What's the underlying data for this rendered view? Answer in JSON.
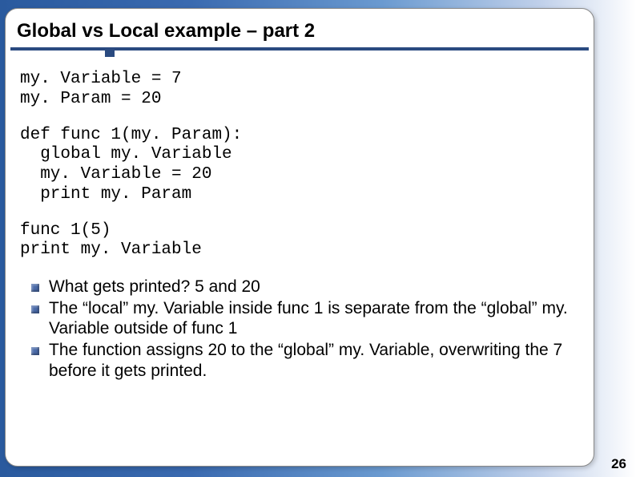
{
  "title": "Global vs Local example – part 2",
  "code": {
    "block1": "my. Variable = 7\nmy. Param = 20",
    "block2": "def func 1(my. Param):\n  global my. Variable\n  my. Variable = 20\n  print my. Param",
    "block3": "func 1(5)\nprint my. Variable"
  },
  "bullets": [
    "What gets printed? 5 and 20",
    "The “local” my. Variable inside func 1 is separate from the “global” my. Variable outside of func 1",
    "The function assigns 20 to the “global” my. Variable, overwriting the 7 before it gets printed."
  ],
  "page_number": "26"
}
